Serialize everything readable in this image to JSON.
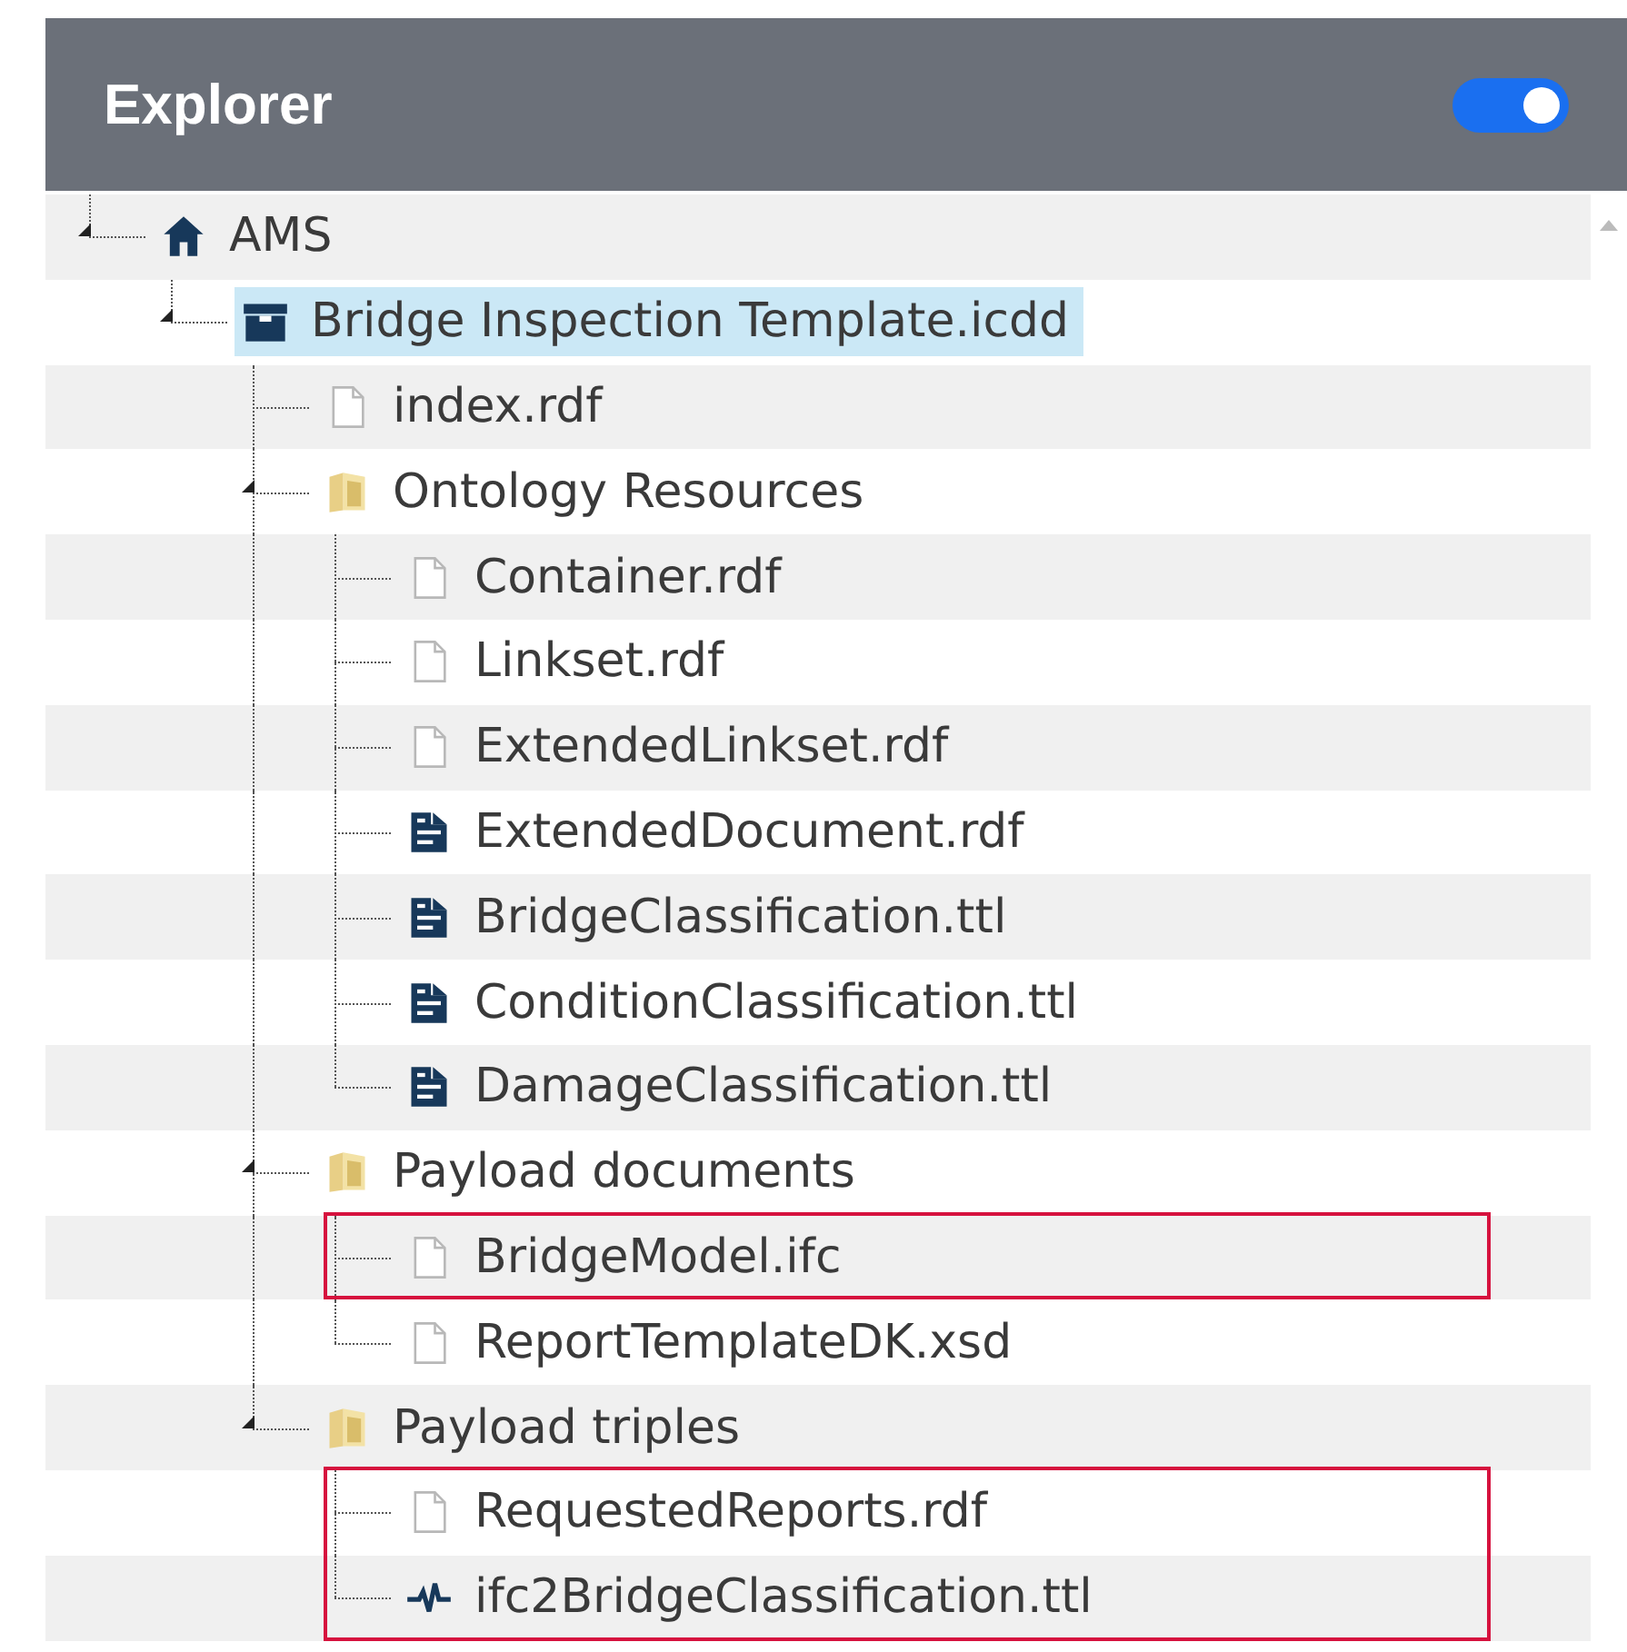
{
  "header": {
    "title": "Explorer",
    "toggle": {
      "on": true
    }
  },
  "tree": [
    {
      "label": "AMS",
      "kind": "home",
      "expanded": true,
      "selected": false,
      "highlighted": false,
      "children": [
        {
          "label": "Bridge Inspection Template.icdd",
          "kind": "package",
          "expanded": true,
          "selected": true,
          "highlighted": false,
          "children": [
            {
              "label": "index.rdf",
              "kind": "file",
              "selected": false,
              "highlighted": false
            },
            {
              "label": "Ontology Resources",
              "kind": "folder",
              "expanded": true,
              "selected": false,
              "highlighted": false,
              "children": [
                {
                  "label": "Container.rdf",
                  "kind": "file",
                  "selected": false,
                  "highlighted": false
                },
                {
                  "label": "Linkset.rdf",
                  "kind": "file",
                  "selected": false,
                  "highlighted": false
                },
                {
                  "label": "ExtendedLinkset.rdf",
                  "kind": "file",
                  "selected": false,
                  "highlighted": false
                },
                {
                  "label": "ExtendedDocument.rdf",
                  "kind": "document",
                  "selected": false,
                  "highlighted": false
                },
                {
                  "label": "BridgeClassification.ttl",
                  "kind": "document",
                  "selected": false,
                  "highlighted": false
                },
                {
                  "label": "ConditionClassification.ttl",
                  "kind": "document",
                  "selected": false,
                  "highlighted": false
                },
                {
                  "label": "DamageClassification.ttl",
                  "kind": "document",
                  "selected": false,
                  "highlighted": false
                }
              ]
            },
            {
              "label": "Payload documents",
              "kind": "folder",
              "expanded": true,
              "selected": false,
              "highlighted": false,
              "children": [
                {
                  "label": "BridgeModel.ifc",
                  "kind": "file",
                  "selected": false,
                  "highlighted": true
                },
                {
                  "label": "ReportTemplateDK.xsd",
                  "kind": "file",
                  "selected": false,
                  "highlighted": false
                }
              ]
            },
            {
              "label": "Payload triples",
              "kind": "folder",
              "expanded": true,
              "selected": false,
              "highlighted": false,
              "children": [
                {
                  "label": "RequestedReports.rdf",
                  "kind": "file",
                  "selected": false,
                  "highlighted": true
                },
                {
                  "label": "ifc2BridgeClassification.ttl",
                  "kind": "pulse",
                  "selected": false,
                  "highlighted": true
                }
              ]
            }
          ]
        }
      ]
    }
  ]
}
